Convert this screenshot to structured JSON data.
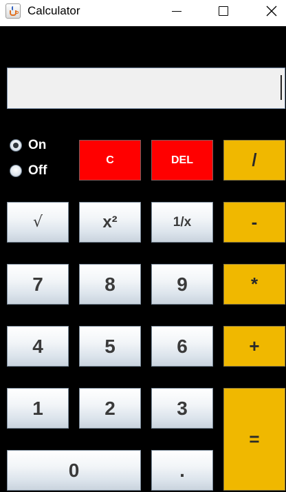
{
  "window": {
    "title": "Calculator"
  },
  "titlebar": {
    "minimize_icon": "minimize-icon",
    "maximize_icon": "maximize-icon",
    "close_icon": "close-icon"
  },
  "display": {
    "value": ""
  },
  "power": {
    "on_label": "On",
    "off_label": "Off",
    "selected": "On"
  },
  "buttons": {
    "clear": "C",
    "delete": "DEL",
    "divide": "/",
    "sqrt": "√",
    "square": "x²",
    "reciprocal": "1/x",
    "subtract": "-",
    "seven": "7",
    "eight": "8",
    "nine": "9",
    "multiply": "*",
    "four": "4",
    "five": "5",
    "six": "6",
    "add": "+",
    "one": "1",
    "two": "2",
    "three": "3",
    "equals": "=",
    "zero": "0",
    "decimal": "."
  },
  "colors": {
    "background": "#000000",
    "clear_delete": "#ff0000",
    "operators": "#f0b800"
  }
}
